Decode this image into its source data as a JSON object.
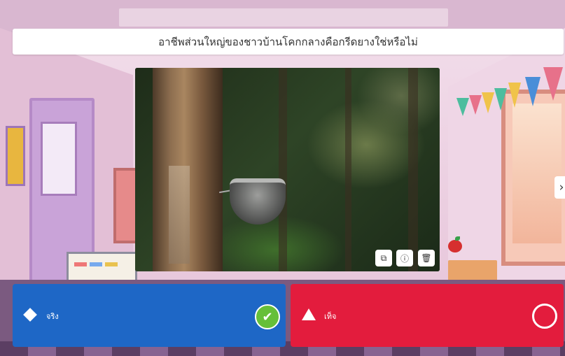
{
  "question": {
    "text": "อาชีพส่วนใหญ่ของชาวบ้านโคกกลางคือกรีดยางใช่หรือไม่"
  },
  "media": {
    "image_icon": "rubber-tapping-photo",
    "buttons": [
      {
        "icon": "crop-icon",
        "glyph": "⧉"
      },
      {
        "icon": "info-icon",
        "glyph": "ⓘ"
      },
      {
        "icon": "trash-icon",
        "glyph": "🗑"
      }
    ]
  },
  "navigation": {
    "next_glyph": "›"
  },
  "answers": {
    "true": {
      "label": "จริง",
      "color": "#1e67c6",
      "shape": "diamond",
      "state": "correct",
      "check_glyph": "✔"
    },
    "false": {
      "label": "เท็จ",
      "color": "#e31c3d",
      "shape": "triangle",
      "state": "unselected"
    }
  }
}
